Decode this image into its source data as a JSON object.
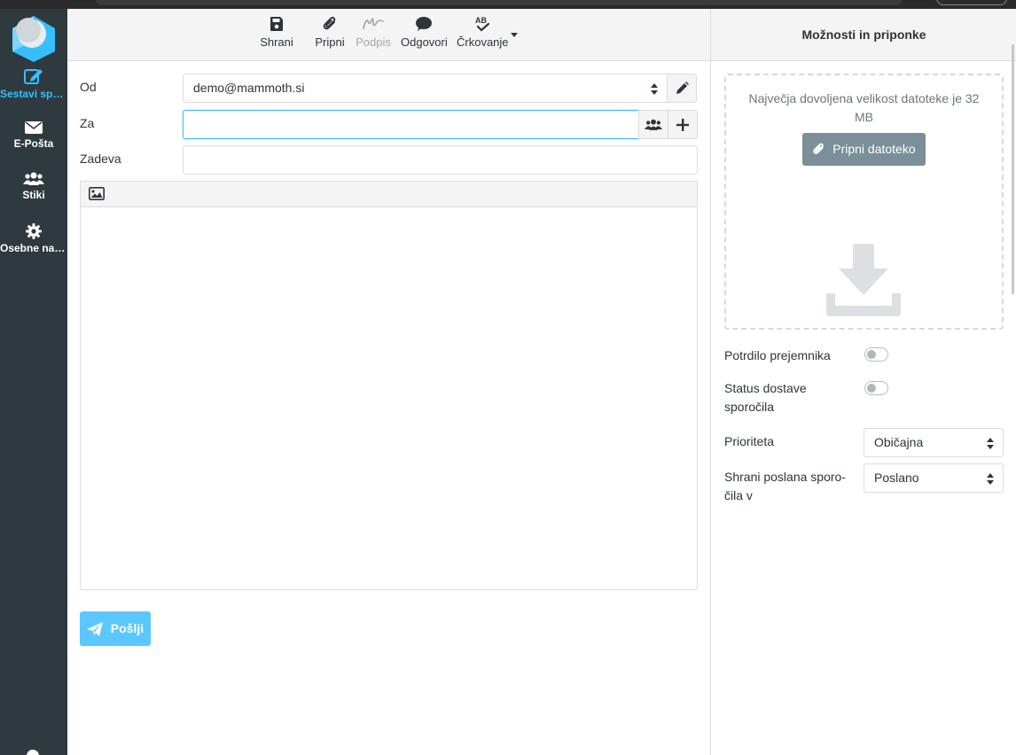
{
  "sidebar": {
    "items": [
      {
        "label": "Sestavi spo…",
        "icon": "compose-icon",
        "active": true
      },
      {
        "label": "E-Pošta",
        "icon": "envelope-icon"
      },
      {
        "label": "Stiki",
        "icon": "users-icon"
      },
      {
        "label": "Osebne nas…",
        "icon": "gear-icon"
      }
    ]
  },
  "toolbar": {
    "save": "Shrani",
    "attach": "Pripni",
    "signature": "Podpis",
    "responses": "Odgovori",
    "spell": "Črkovanje"
  },
  "form": {
    "from_label": "Od",
    "from_value": "demo@mammoth.si",
    "to_label": "Za",
    "to_value": "",
    "subject_label": "Zadeva",
    "subject_value": ""
  },
  "send_label": "Pošlji",
  "options": {
    "title": "Možnosti in priponke",
    "max_size_text": "Največja dovoljena velikost datoteke je 32 MB",
    "attach_file": "Pripni datoteko",
    "receipt_label": "Potrdilo prejemnika",
    "receipt_on": false,
    "dsn_label": "Status dostave sporočila",
    "dsn_on": false,
    "priority_label": "Prioriteta",
    "priority_value": "Običajna",
    "store_label": "Shrani poslana sporo-čila v",
    "store_value": "Poslano"
  },
  "colors": {
    "accent": "#37beff",
    "sidebar_bg": "#2f3a3f",
    "send_button": "#5bc7ff"
  }
}
